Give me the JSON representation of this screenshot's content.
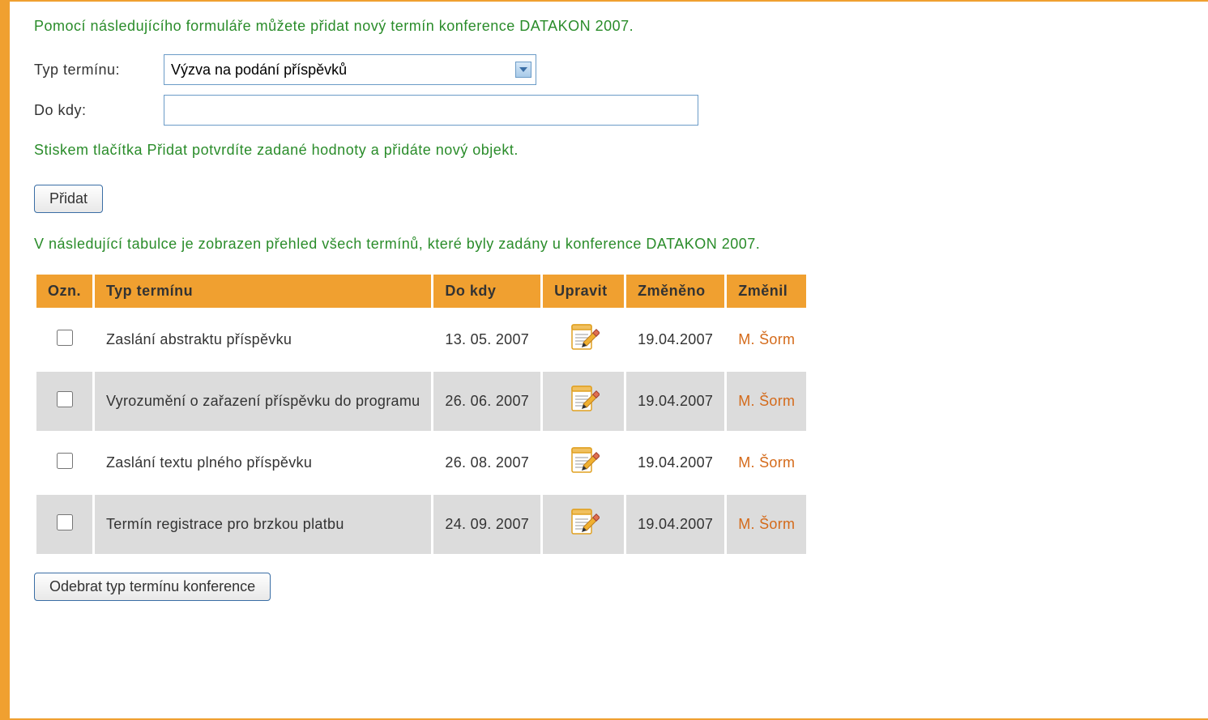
{
  "intro_text": "Pomocí následujícího formuláře můžete přidat nový termín konference DATAKON 2007.",
  "form": {
    "type_label": "Typ termínu:",
    "type_value": "Výzva na podání příspěvků",
    "until_label": "Do kdy:",
    "until_value": ""
  },
  "confirm_text": "Stiskem tlačítka Přidat potvrdíte zadané hodnoty a přidáte nový objekt.",
  "add_button": "Přidat",
  "table_intro": "V následující tabulce je zobrazen přehled všech termínů, které byly zadány u konference DATAKON 2007.",
  "table": {
    "headers": {
      "mark": "Ozn.",
      "type": "Typ termínu",
      "until": "Do kdy",
      "edit": "Upravit",
      "changed": "Změněno",
      "changed_by": "Změnil"
    },
    "rows": [
      {
        "type": "Zaslání abstraktu příspěvku",
        "until": "13. 05. 2007",
        "changed": "19.04.2007",
        "changed_by": "M. Šorm"
      },
      {
        "type": "Vyrozumění o zařazení příspěvku do programu",
        "until": "26. 06. 2007",
        "changed": "19.04.2007",
        "changed_by": "M. Šorm"
      },
      {
        "type": "Zaslání textu plného příspěvku",
        "until": "26. 08. 2007",
        "changed": "19.04.2007",
        "changed_by": "M. Šorm"
      },
      {
        "type": "Termín registrace pro brzkou platbu",
        "until": "24. 09. 2007",
        "changed": "19.04.2007",
        "changed_by": "M. Šorm"
      }
    ]
  },
  "remove_button": "Odebrat typ termínu konference"
}
